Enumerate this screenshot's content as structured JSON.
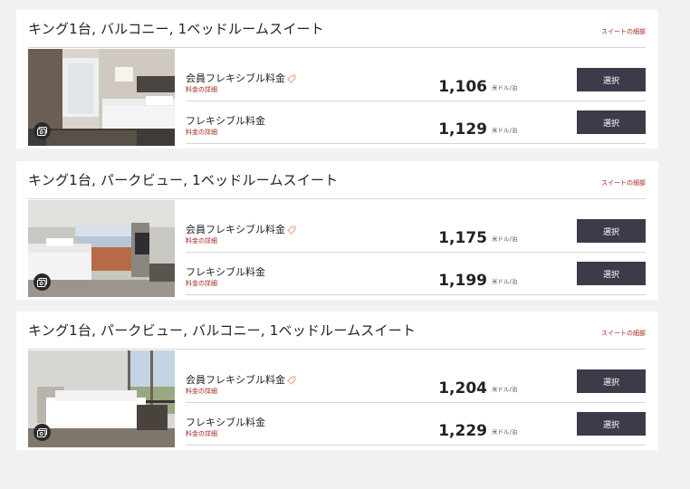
{
  "suites": [
    {
      "title": "キング1台, バルコニー, 1ベッドルームスイート",
      "details_link": "スイートの細部",
      "rates": [
        {
          "name": "会員フレキシブル料金",
          "member": true,
          "sub": "料金の詳細",
          "price": "1,106",
          "unit": "米ドル/泊",
          "button": "選択"
        },
        {
          "name": "フレキシブル料金",
          "member": false,
          "sub": "料金の詳細",
          "price": "1,129",
          "unit": "米ドル/泊",
          "button": "選択"
        }
      ]
    },
    {
      "title": "キング1台, パークビュー, 1ベッドルームスイート",
      "details_link": "スイートの細部",
      "rates": [
        {
          "name": "会員フレキシブル料金",
          "member": true,
          "sub": "料金の詳細",
          "price": "1,175",
          "unit": "米ドル/泊",
          "button": "選択"
        },
        {
          "name": "フレキシブル料金",
          "member": false,
          "sub": "料金の詳細",
          "price": "1,199",
          "unit": "米ドル/泊",
          "button": "選択"
        }
      ]
    },
    {
      "title": "キング1台, パークビュー, バルコニー, 1ベッドルームスイート",
      "details_link": "スイートの細部",
      "rates": [
        {
          "name": "会員フレキシブル料金",
          "member": true,
          "sub": "料金の詳細",
          "price": "1,204",
          "unit": "米ドル/泊",
          "button": "選択"
        },
        {
          "name": "フレキシブル料金",
          "member": false,
          "sub": "料金の詳細",
          "price": "1,229",
          "unit": "米ドル/泊",
          "button": "選択"
        }
      ]
    }
  ],
  "colors": {
    "accent": "#a5261b",
    "button": "#3d3a4a",
    "page_bg": "#f1f1f1"
  },
  "icons": {
    "member_rate": "tag-icon",
    "gallery": "camera-gallery-icon"
  }
}
